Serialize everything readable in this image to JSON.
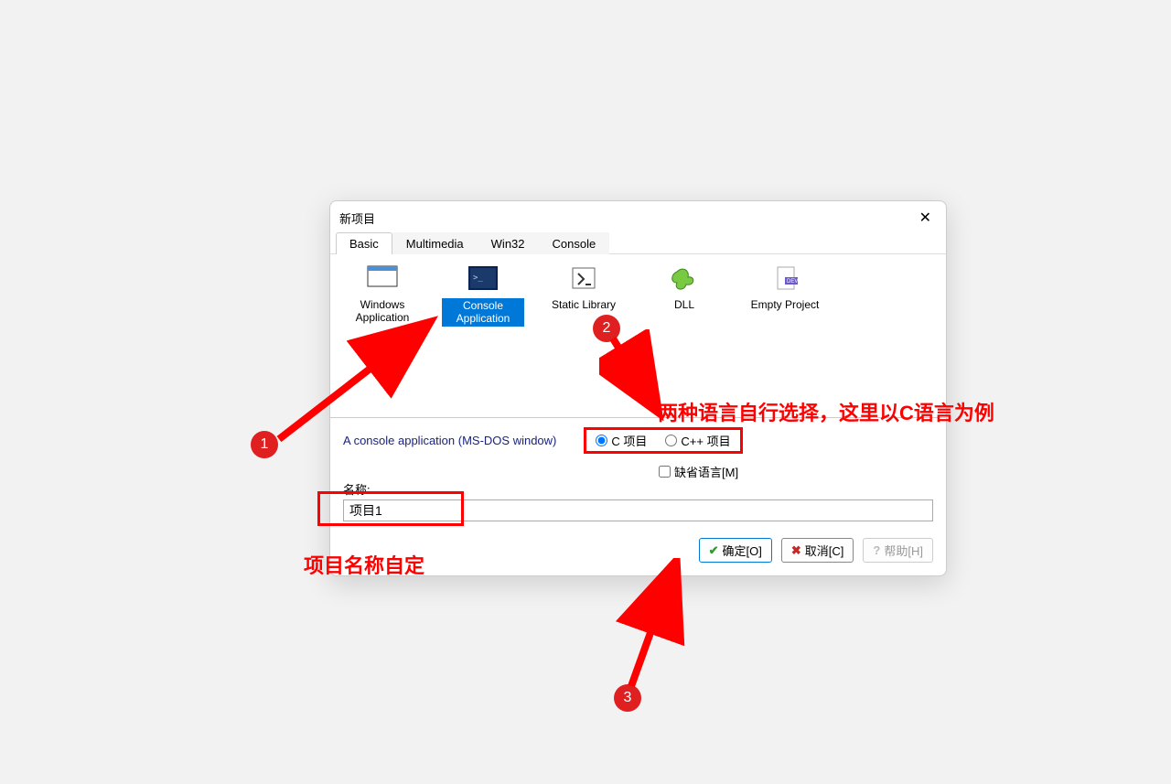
{
  "dialog": {
    "title": "新项目",
    "tabs": [
      "Basic",
      "Multimedia",
      "Win32",
      "Console"
    ],
    "activeTab": 0,
    "projects": [
      {
        "label": "Windows Application"
      },
      {
        "label": "Console Application"
      },
      {
        "label": "Static Library"
      },
      {
        "label": "DLL"
      },
      {
        "label": "Empty Project"
      }
    ],
    "selectedProject": 1,
    "description": "A console application (MS-DOS window)",
    "radios": {
      "c": "C 项目",
      "cpp": "C++ 项目",
      "selected": "c"
    },
    "defaultLangLabel": "缺省语言[M]",
    "nameLabel": "名称:",
    "nameValue": "项目1",
    "buttons": {
      "ok": "确定[O]",
      "cancel": "取消[C]",
      "help": "帮助[H]"
    }
  },
  "annotations": {
    "badge1": "1",
    "badge2": "2",
    "badge3": "3",
    "langNote": "两种语言自行选择，这里以C语言为例",
    "nameNote": "项目名称自定"
  }
}
